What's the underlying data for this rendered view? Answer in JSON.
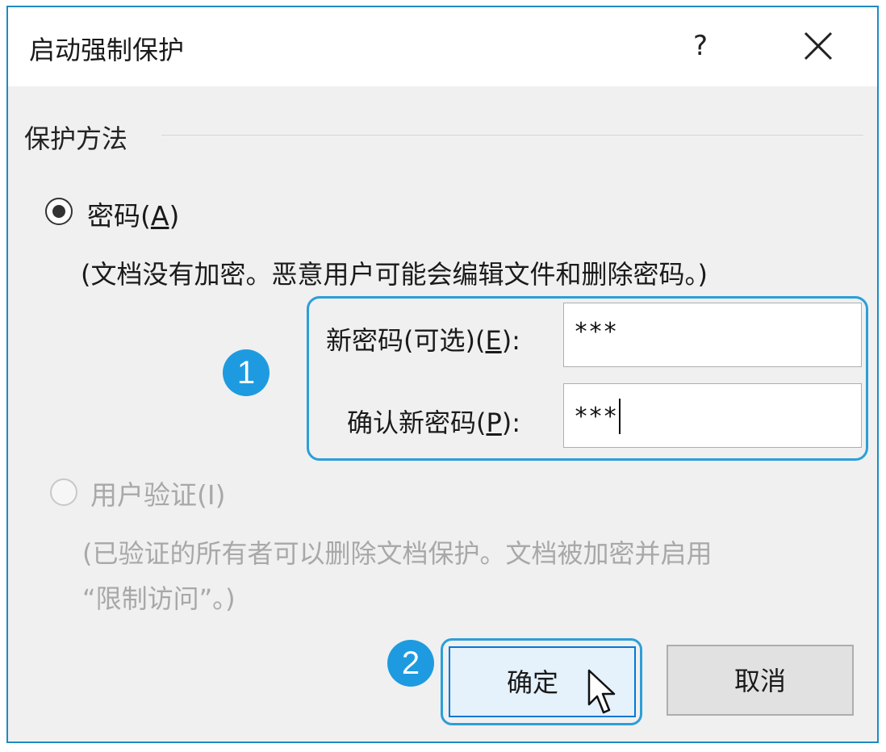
{
  "dialog": {
    "title": "启动强制保护",
    "help_label": "?",
    "close_icon": "close-icon"
  },
  "protection": {
    "section_label": "保护方法",
    "password_option": {
      "label_main": "密码(",
      "label_key": "A",
      "label_end": ")",
      "checked": true,
      "description": "(文档没有加密。恶意用户可能会编辑文件和删除密码。)"
    },
    "new_password": {
      "label_main": "新密码(可选)(",
      "label_key": "E",
      "label_end": "):",
      "value": "***"
    },
    "confirm_password": {
      "label_main": "确认新密码(",
      "label_key": "P",
      "label_end": "):",
      "value": "***"
    },
    "user_auth_option": {
      "label": "用户验证(I)",
      "checked": false,
      "disabled": true,
      "description_line1": "(已验证的所有者可以删除文档保护。文档被加密并启用",
      "description_line2": "“限制访问”。)"
    }
  },
  "callouts": {
    "step1": "1",
    "step2": "2"
  },
  "buttons": {
    "ok_label": "确定",
    "cancel_label": "取消"
  },
  "colors": {
    "callout": "#2b9fd9",
    "badge": "#1e9be0",
    "dialog_border": "#1e8bc3",
    "ok_border": "#0078d7"
  }
}
